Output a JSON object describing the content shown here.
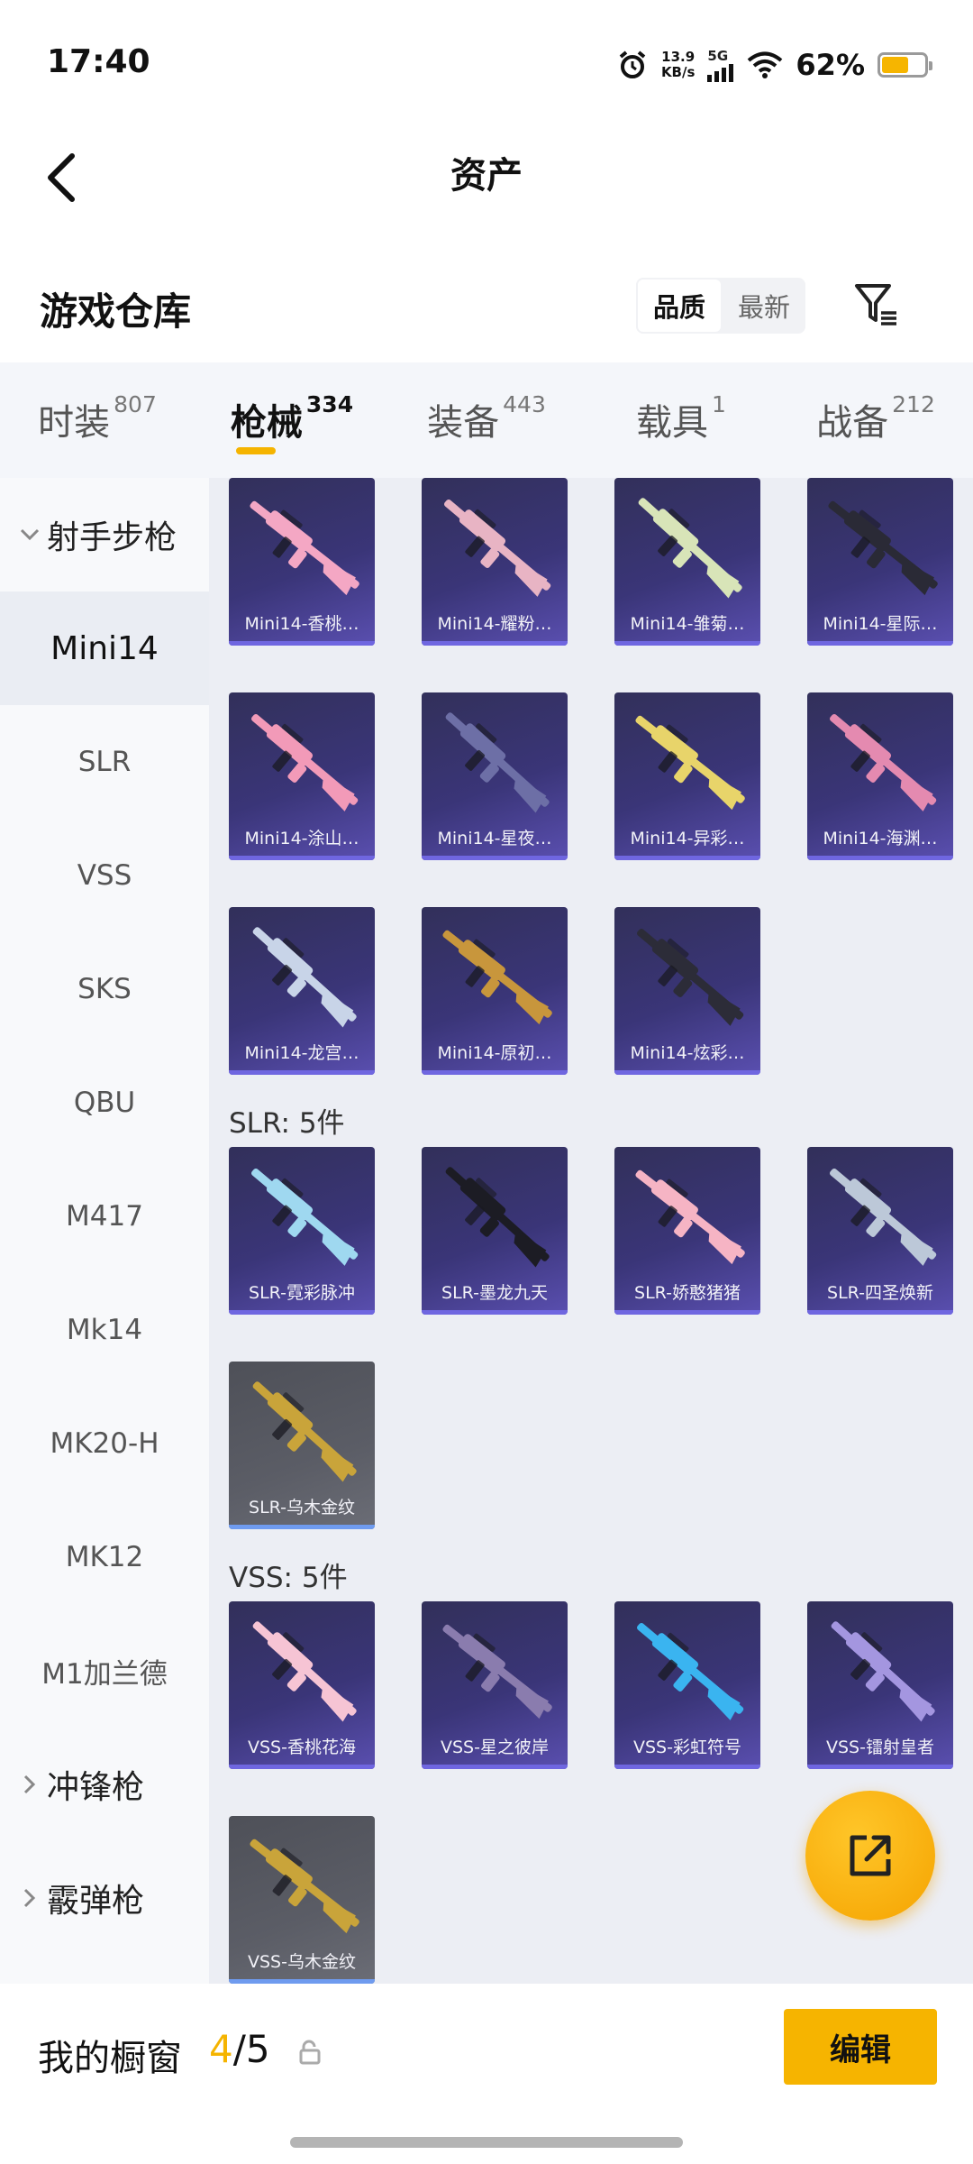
{
  "status_bar": {
    "time": "17:40",
    "speed_value": "13.9",
    "speed_unit": "KB/s",
    "network": "5G",
    "battery_text": "62%",
    "battery_level": 0.62,
    "battery_color": "#f6b500"
  },
  "header": {
    "title": "资产"
  },
  "section": {
    "title": "游戏仓库",
    "sort_options": [
      "品质",
      "最新"
    ],
    "sort_selected": "品质"
  },
  "tabs": [
    {
      "label": "时装",
      "count": "807"
    },
    {
      "label": "枪械",
      "count": "334",
      "active": true
    },
    {
      "label": "装备",
      "count": "443"
    },
    {
      "label": "载具",
      "count": "1"
    },
    {
      "label": "战备",
      "count": "212"
    }
  ],
  "sidebar": [
    {
      "label": "射手步枪",
      "type": "group",
      "expanded": true
    },
    {
      "label": "Mini14",
      "selected": true
    },
    {
      "label": "SLR"
    },
    {
      "label": "VSS"
    },
    {
      "label": "SKS"
    },
    {
      "label": "QBU"
    },
    {
      "label": "M417"
    },
    {
      "label": "Mk14"
    },
    {
      "label": "MK20-H"
    },
    {
      "label": "MK12"
    },
    {
      "label": "M1加兰德"
    },
    {
      "label": "冲锋枪",
      "type": "group",
      "expanded": false
    },
    {
      "label": "霰弹枪",
      "type": "group",
      "expanded": false
    }
  ],
  "groups": [
    {
      "heading": "",
      "items": [
        {
          "name": "Mini14-香桃…",
          "color": "#f4a7c4"
        },
        {
          "name": "Mini14-耀粉…",
          "color": "#e8b4c4"
        },
        {
          "name": "Mini14-雏菊…",
          "color": "#d8e4b8"
        },
        {
          "name": "Mini14-星际…",
          "color": "#2a2a36"
        },
        {
          "name": "Mini14-涂山…",
          "color": "#f29ab8"
        },
        {
          "name": "Mini14-星夜…",
          "color": "#6d6fa6"
        },
        {
          "name": "Mini14-异彩…",
          "color": "#e8d46a"
        },
        {
          "name": "Mini14-海渊…",
          "color": "#e48ab0"
        },
        {
          "name": "Mini14-龙宫…",
          "color": "#c8d4e8"
        },
        {
          "name": "Mini14-原初…",
          "color": "#c8963c"
        },
        {
          "name": "Mini14-炫彩…",
          "color": "#2c2c38"
        }
      ]
    },
    {
      "heading": "SLR: 5件",
      "items": [
        {
          "name": "SLR-霓彩脉冲",
          "color": "#9fd8f0"
        },
        {
          "name": "SLR-墨龙九天",
          "color": "#1c1c24"
        },
        {
          "name": "SLR-娇憨猪猪",
          "color": "#f6b4c4"
        },
        {
          "name": "SLR-四圣焕新",
          "color": "#bcc8d8"
        },
        {
          "name": "SLR-乌木金纹",
          "color": "#c9a43a",
          "gray": true
        }
      ]
    },
    {
      "heading": "VSS: 5件",
      "items": [
        {
          "name": "VSS-香桃花海",
          "color": "#f6c4d4"
        },
        {
          "name": "VSS-星之彼岸",
          "color": "#8a7cae"
        },
        {
          "name": "VSS-彩虹符号",
          "color": "#3ab4f0"
        },
        {
          "name": "VSS-镭射皇者",
          "color": "#a496e0"
        },
        {
          "name": "VSS-乌木金纹",
          "color": "#c9a43a",
          "gray": true
        }
      ]
    }
  ],
  "footer": {
    "label": "我的橱窗",
    "current": "4",
    "total": "/5",
    "edit_label": "编辑",
    "accent": "#f6b400"
  },
  "icons": {
    "back": "chevron-left-icon",
    "filter": "filter-icon",
    "fab": "share-external-icon",
    "lock": "lock-icon"
  }
}
